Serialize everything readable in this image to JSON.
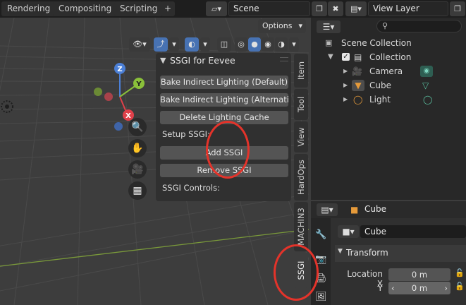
{
  "workspace_tabs": [
    "Rendering",
    "Compositing",
    "Scripting"
  ],
  "add_tab_label": "+",
  "scene": {
    "value": "Scene"
  },
  "view_layer": {
    "value": "View Layer"
  },
  "viewport": {
    "options_label": "Options",
    "gizmo_axes": {
      "z": "Z",
      "y": "Y",
      "x": "X"
    }
  },
  "npanel": {
    "title": "SSGI for Eevee",
    "buttons": {
      "bake_default": "Bake Indirect Lighting (Default)",
      "bake_alt": "Bake Indirect Lighting (Alternati...",
      "delete_cache": "Delete Lighting Cache",
      "add_ssgi": "Add SSGI",
      "remove_ssgi": "Remove SSGI"
    },
    "labels": {
      "setup": "Setup SSGI:",
      "controls": "SSGI Controls:"
    }
  },
  "vertical_tabs": [
    "Item",
    "Tool",
    "View",
    "HardOps",
    "MACHIN3",
    "SSGI"
  ],
  "outliner": {
    "rows": [
      "Scene Collection",
      "Collection",
      "Camera",
      "Cube",
      "Light"
    ]
  },
  "properties": {
    "object_name": "Cube",
    "data_name": "Cube",
    "section_title": "Transform",
    "location_x_label": "Location X",
    "y_label": "Y",
    "x_value": "0 m",
    "y_value": "0 m"
  },
  "colors": {
    "highlight_circle": "#e4332a",
    "accent_blue": "#4772b3"
  }
}
